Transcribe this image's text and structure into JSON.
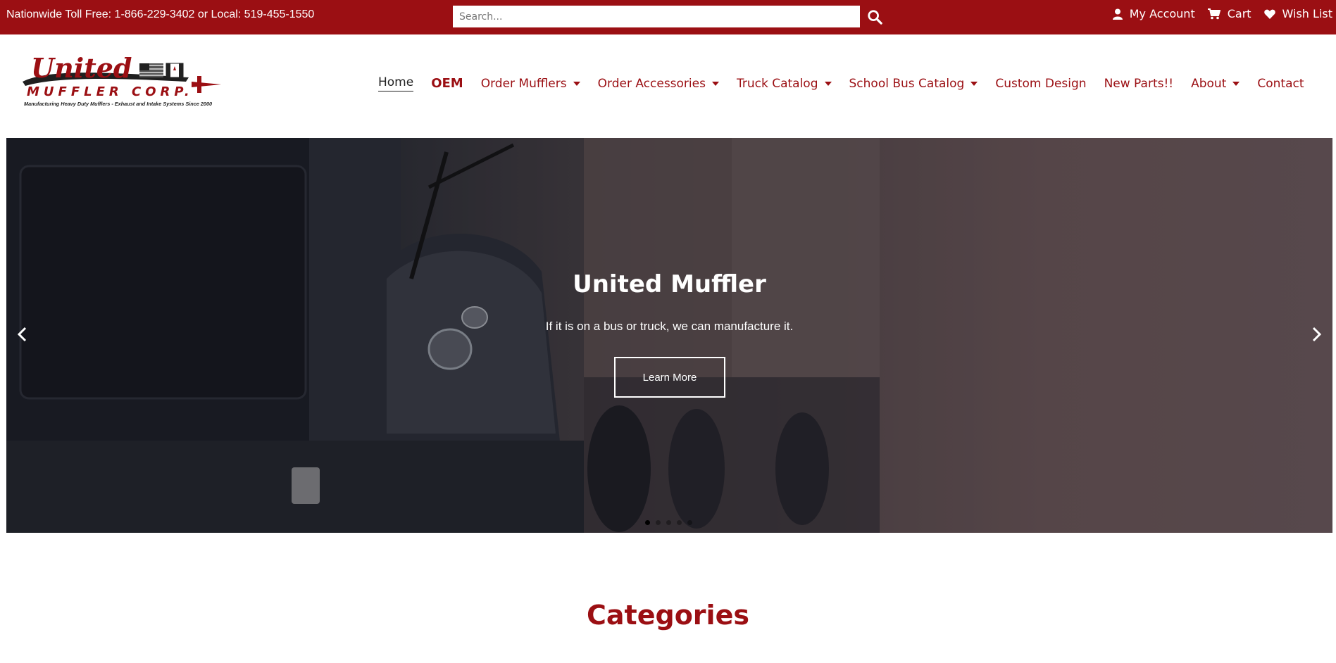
{
  "topbar": {
    "phone_text": "Nationwide Toll Free: 1-866-229-3402 or Local: 519-455-1550",
    "search_placeholder": "Search...",
    "search_icon": "search-icon",
    "account": {
      "label": "My Account",
      "icon": "user-icon"
    },
    "cart": {
      "label": "Cart",
      "icon": "cart-icon"
    },
    "wishlist": {
      "label": "Wish List",
      "icon": "heart-icon"
    }
  },
  "logo": {
    "name": "United",
    "subname": "MUFFLER CORP.",
    "tagline": "Manufacturing Heavy Duty Mufflers - Exhaust and Intake Systems Since 2000"
  },
  "nav": {
    "items": [
      {
        "label": "Home",
        "dropdown": false,
        "active": true
      },
      {
        "label": "OEM",
        "dropdown": false
      },
      {
        "label": "Order Mufflers",
        "dropdown": true
      },
      {
        "label": "Order Accessories",
        "dropdown": true
      },
      {
        "label": "Truck Catalog",
        "dropdown": true
      },
      {
        "label": "School Bus Catalog",
        "dropdown": true
      },
      {
        "label": "Custom Design",
        "dropdown": false
      },
      {
        "label": "New Parts!!",
        "dropdown": false
      },
      {
        "label": "About",
        "dropdown": true
      },
      {
        "label": "Contact",
        "dropdown": false
      }
    ]
  },
  "hero": {
    "title": "United Muffler",
    "subtitle": "If it is on a bus or truck, we can manufacture it.",
    "button_label": "Learn More",
    "prev_icon": "chevron-left-icon",
    "next_icon": "chevron-right-icon",
    "slide_count": 5,
    "active_slide": 1
  },
  "categories": {
    "heading": "Categories"
  },
  "colors": {
    "brand": "#9b0f13",
    "white": "#ffffff",
    "text_dark": "#222222"
  }
}
